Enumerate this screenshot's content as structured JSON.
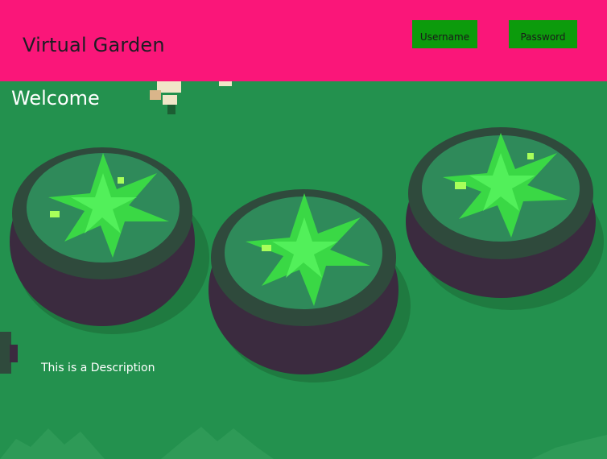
{
  "header": {
    "title": "Virtual Garden",
    "username_label": "Username",
    "password_label": "Password"
  },
  "main": {
    "welcome": "Welcome",
    "description": "This is a Description"
  },
  "colors": {
    "header_bg": "#fa1679",
    "grass": "#23914e",
    "button_bg": "#0c9b0c"
  }
}
